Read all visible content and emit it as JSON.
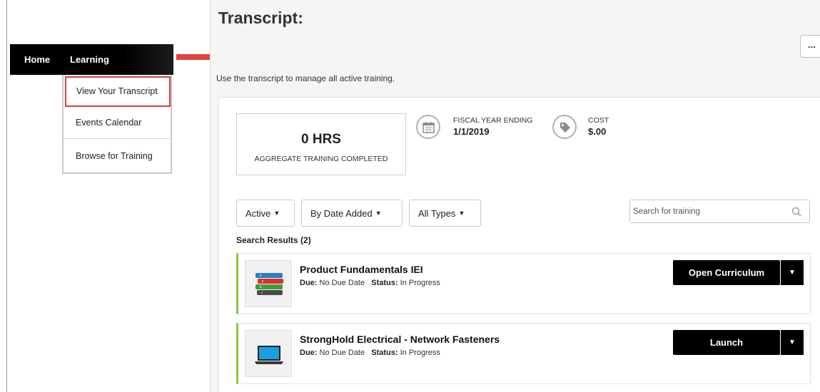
{
  "nav": {
    "home": "Home",
    "learning": "Learning"
  },
  "dropdown": {
    "items": [
      "View Your Transcript",
      "Events Calendar",
      "Browse for Training"
    ]
  },
  "page": {
    "title": "Transcript:",
    "more_label": "...",
    "subtitle": "Use the transcript to manage all active training."
  },
  "stats": {
    "hours_value": "0 HRS",
    "hours_label": "AGGREGATE TRAINING COMPLETED",
    "fiscal_label": "FISCAL YEAR ENDING",
    "fiscal_value": "1/1/2019",
    "cost_label": "COST",
    "cost_value": "$.00"
  },
  "filters": {
    "status": "Active",
    "sort": "By Date Added",
    "type": "All Types"
  },
  "search": {
    "placeholder": "Search for training"
  },
  "results": {
    "count_label": "Search Results (2)",
    "due_label": "Due:",
    "status_label": "Status:",
    "items": [
      {
        "title": "Product Fundamentals IEI",
        "due": "No Due Date",
        "status": "In Progress",
        "action": "Open Curriculum",
        "icon": "books-icon"
      },
      {
        "title": "StrongHold Electrical - Network Fasteners",
        "due": "No Due Date",
        "status": "In Progress",
        "action": "Launch",
        "icon": "laptop-icon"
      }
    ]
  },
  "colors": {
    "accent_red": "#e3413b",
    "progress_green": "#8cc63f",
    "nav_black": "#000000"
  }
}
